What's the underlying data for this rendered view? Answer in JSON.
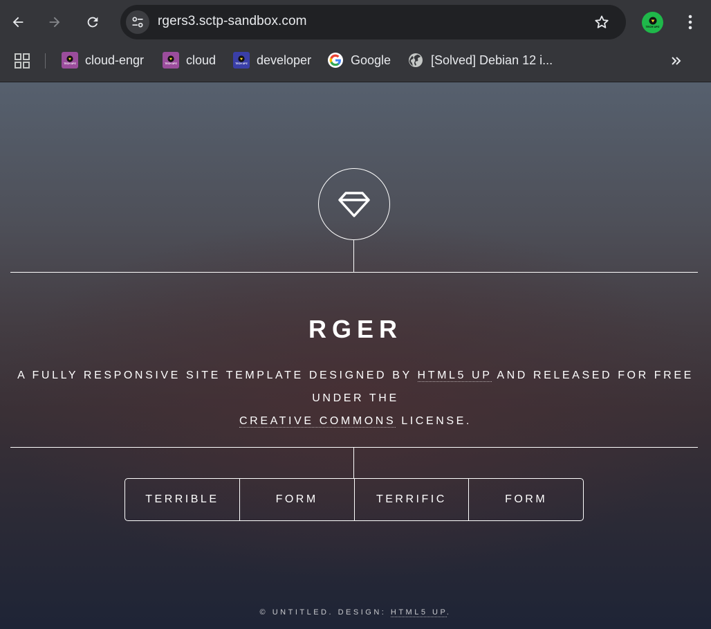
{
  "browser": {
    "url": "rgers3.sctp-sandbox.com",
    "profile_badge": "TECH UPZ",
    "bookmarks": [
      {
        "label": "cloud-engr",
        "favicon_badge": "TECH UPZ",
        "favicon_color": "#9b4d9c"
      },
      {
        "label": "cloud",
        "favicon_badge": "TECH UPZ",
        "favicon_color": "#9b4d9c"
      },
      {
        "label": "developer",
        "favicon_badge": "TECH UPZ",
        "favicon_color": "#3a3fa8"
      },
      {
        "label": "Google",
        "favicon": "google-icon"
      },
      {
        "label": "[Solved] Debian 12 i...",
        "favicon": "globe-icon"
      }
    ]
  },
  "site": {
    "title": "RGER",
    "description_prefix": "A fully responsive site template designed by ",
    "description_link1": "HTML5 UP",
    "description_middle": " and released for free under the ",
    "description_link2": "Creative Commons",
    "description_suffix": " license.",
    "nav": [
      "TERRIBLE",
      "FORM",
      "TERRIFIC",
      "FORM"
    ],
    "footer_prefix": "© UNTITLED. DESIGN: ",
    "footer_link": "HTML5 UP",
    "footer_suffix": "."
  },
  "colors": {
    "chrome_bg": "#35363a",
    "omnibox_bg": "#202124",
    "profile_green": "#1fb84a",
    "page_top": "#56606e",
    "page_bottom": "#1e2436"
  }
}
